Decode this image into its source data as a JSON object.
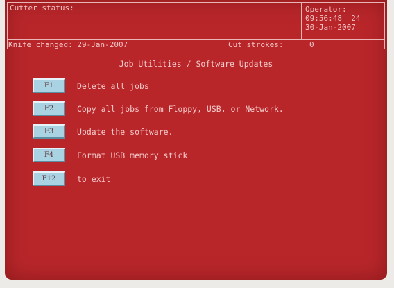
{
  "header": {
    "cutter_status_label": "Cutter status:",
    "operator_label": "Operator:",
    "time": "09:56:48  24",
    "date": "30-Jan-2007",
    "knife_changed": "Knife changed: 29-Jan-2007",
    "cut_strokes_label": "Cut strokes:",
    "cut_strokes_value": "0"
  },
  "title": "Job Utilities / Software Updates",
  "options": [
    {
      "key": "F1",
      "label": "Delete all jobs"
    },
    {
      "key": "F2",
      "label": "Copy all jobs from Floppy, USB, or Network."
    },
    {
      "key": "F3",
      "label": "Update the software."
    },
    {
      "key": "F4",
      "label": "Format USB memory stick"
    },
    {
      "key": "F12",
      "label": "to exit"
    }
  ],
  "colors": {
    "screen_background": "#b8262a",
    "text": "#f4caca",
    "key_button": "#a9d2e3"
  }
}
